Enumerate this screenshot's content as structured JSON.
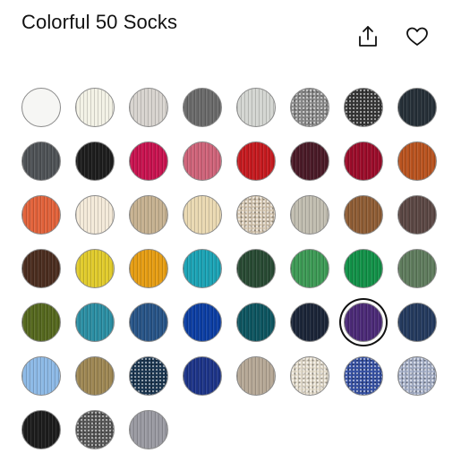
{
  "product": {
    "title": "Colorful 50 Socks"
  },
  "actions": {
    "share_icon": "share-icon",
    "favorite_icon": "heart-icon"
  },
  "swatches": [
    {
      "color": "#f6f6f4",
      "texture": "plain"
    },
    {
      "color": "#f3f2e6",
      "texture": "rib"
    },
    {
      "color": "#d8d4cf",
      "texture": "rib"
    },
    {
      "color": "#6a6a6a",
      "texture": "rib"
    },
    {
      "color": "#d4d6d2",
      "texture": "rib"
    },
    {
      "color": "#8f8f8f",
      "texture": "heather"
    },
    {
      "color": "#3a3a3a",
      "texture": "heather"
    },
    {
      "color": "#263038",
      "texture": "rib"
    },
    {
      "color": "#4e5256",
      "texture": "rib"
    },
    {
      "color": "#1d1d1d",
      "texture": "rib"
    },
    {
      "color": "#c8124f",
      "texture": "rib"
    },
    {
      "color": "#cf6379",
      "texture": "rib"
    },
    {
      "color": "#c51a1f",
      "texture": "rib"
    },
    {
      "color": "#4a1a27",
      "texture": "rib"
    },
    {
      "color": "#9b0c2a",
      "texture": "rib"
    },
    {
      "color": "#b9531f",
      "texture": "rib"
    },
    {
      "color": "#e2623a",
      "texture": "rib"
    },
    {
      "color": "#f4ead9",
      "texture": "rib"
    },
    {
      "color": "#c6b190",
      "texture": "rib"
    },
    {
      "color": "#ead9b2",
      "texture": "rib"
    },
    {
      "color": "#d9cbb6",
      "texture": "heather"
    },
    {
      "color": "#c1bdb0",
      "texture": "rib"
    },
    {
      "color": "#8f5d35",
      "texture": "rib"
    },
    {
      "color": "#5b4744",
      "texture": "rib"
    },
    {
      "color": "#4b2d1f",
      "texture": "rib"
    },
    {
      "color": "#e1cb2b",
      "texture": "rib"
    },
    {
      "color": "#e69d12",
      "texture": "rib"
    },
    {
      "color": "#1ba3b5",
      "texture": "rib"
    },
    {
      "color": "#284a33",
      "texture": "rib"
    },
    {
      "color": "#3d9a55",
      "texture": "rib"
    },
    {
      "color": "#129148",
      "texture": "rib"
    },
    {
      "color": "#5f7c5d",
      "texture": "rib"
    },
    {
      "color": "#55681e",
      "texture": "rib"
    },
    {
      "color": "#2b8ea3",
      "texture": "rib"
    },
    {
      "color": "#275487",
      "texture": "rib"
    },
    {
      "color": "#0c3ea3",
      "texture": "rib"
    },
    {
      "color": "#0d5560",
      "texture": "rib"
    },
    {
      "color": "#1b2538",
      "texture": "rib"
    },
    {
      "color": "#4b2a77",
      "texture": "rib",
      "selected": true
    },
    {
      "color": "#243a5e",
      "texture": "rib"
    },
    {
      "color": "#8cb9e6",
      "texture": "rib"
    },
    {
      "color": "#9e8753",
      "texture": "rib"
    },
    {
      "color": "#1e3a55",
      "texture": "heather"
    },
    {
      "color": "#1d3488",
      "texture": "rib"
    },
    {
      "color": "#b6a896",
      "texture": "rib"
    },
    {
      "color": "#e6dece",
      "texture": "heather"
    },
    {
      "color": "#3a55a8",
      "texture": "heather"
    },
    {
      "color": "#aab4cc",
      "texture": "heather"
    },
    {
      "color": "#1c1c1c",
      "texture": "rib"
    },
    {
      "color": "#5c5c5c",
      "texture": "heather"
    },
    {
      "color": "#9a9aa2",
      "texture": "rib"
    }
  ]
}
